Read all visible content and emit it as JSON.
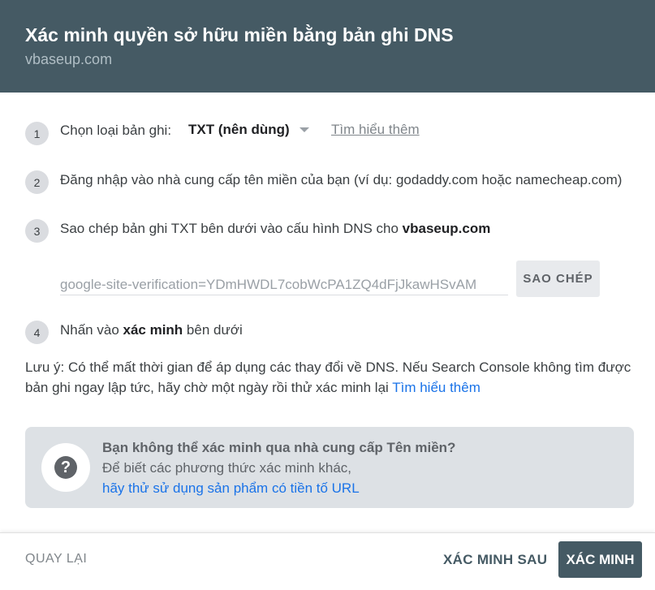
{
  "header": {
    "title": "Xác minh quyền sở hữu miền bằng bản ghi DNS",
    "subtitle": "vbaseup.com"
  },
  "steps": [
    {
      "num": "1",
      "text": "Chọn loại bản ghi:"
    },
    {
      "num": "2",
      "text": "Đăng nhập vào nhà cung cấp tên miền của bạn (ví dụ: godaddy.com hoặc namecheap.com)"
    },
    {
      "num": "3",
      "text": "Sao chép bản ghi TXT bên dưới vào cấu hình DNS cho ",
      "bold": "vbaseup.com"
    },
    {
      "num": "4",
      "text": "Nhấn vào ",
      "bold": "xác minh",
      "after": " bên dưới"
    }
  ],
  "record_type": {
    "selected": "TXT (nên dùng)",
    "learn_more": "Tìm hiểu thêm"
  },
  "record": {
    "value": "google-site-verification=YDmHWDL7cobWcPA1ZQ4dFjJkawHSvAM",
    "copy_label": "SAO CHÉP"
  },
  "note": {
    "text": "Lưu ý: Có thể mất thời gian để áp dụng các thay đổi về DNS. Nếu Search Console không tìm được bản ghi ngay lập tức, hãy chờ một ngày rồi thử xác minh lại ",
    "link": "Tìm hiểu thêm"
  },
  "help": {
    "title": "Bạn không thể xác minh qua nhà cung cấp Tên miền?",
    "line": "Để biết các phương thức xác minh khác,",
    "link": "hãy thử sử dụng sản phẩm có tiền tố URL",
    "icon": "?"
  },
  "footer": {
    "back": "QUAY LẠI",
    "later": "XÁC MINH SAU",
    "verify": "XÁC MINH"
  },
  "colors": {
    "header": "#455a64",
    "link": "#1a73e8",
    "help_bg": "#dde1e5"
  }
}
